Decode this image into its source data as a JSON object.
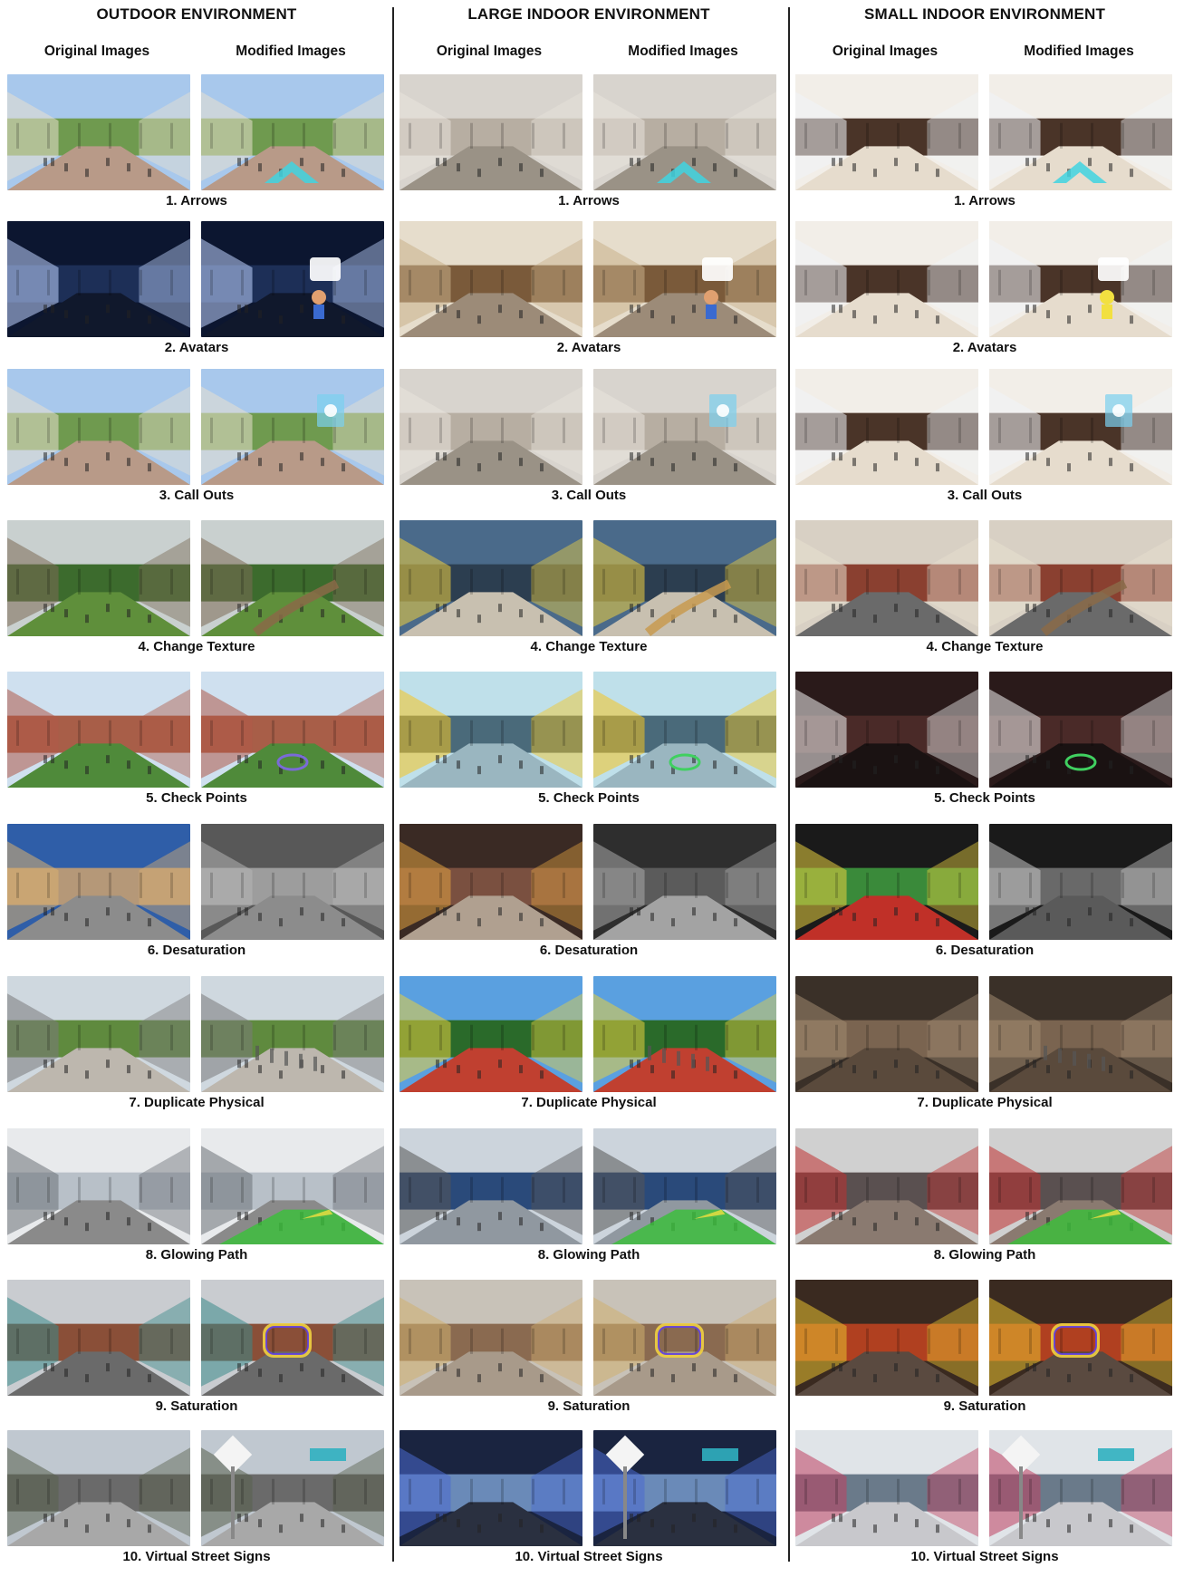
{
  "columns": [
    {
      "id": "outdoor",
      "title": "OUTDOOR ENVIRONMENT",
      "original_label": "Original Images",
      "modified_label": "Modified Images"
    },
    {
      "id": "large-indoor",
      "title": "LARGE INDOOR ENVIRONMENT",
      "original_label": "Original Images",
      "modified_label": "Modified Images"
    },
    {
      "id": "small-indoor",
      "title": "SMALL INDOOR ENVIRONMENT",
      "original_label": "Original Images",
      "modified_label": "Modified Images"
    }
  ],
  "techniques": [
    "1. Arrows",
    "2. Avatars",
    "3. Call Outs",
    "4. Change Texture",
    "5. Check Points",
    "6. Desaturation",
    "7. Duplicate Physical",
    "8. Glowing Path",
    "9. Saturation",
    "10. Virtual Street Signs"
  ]
}
